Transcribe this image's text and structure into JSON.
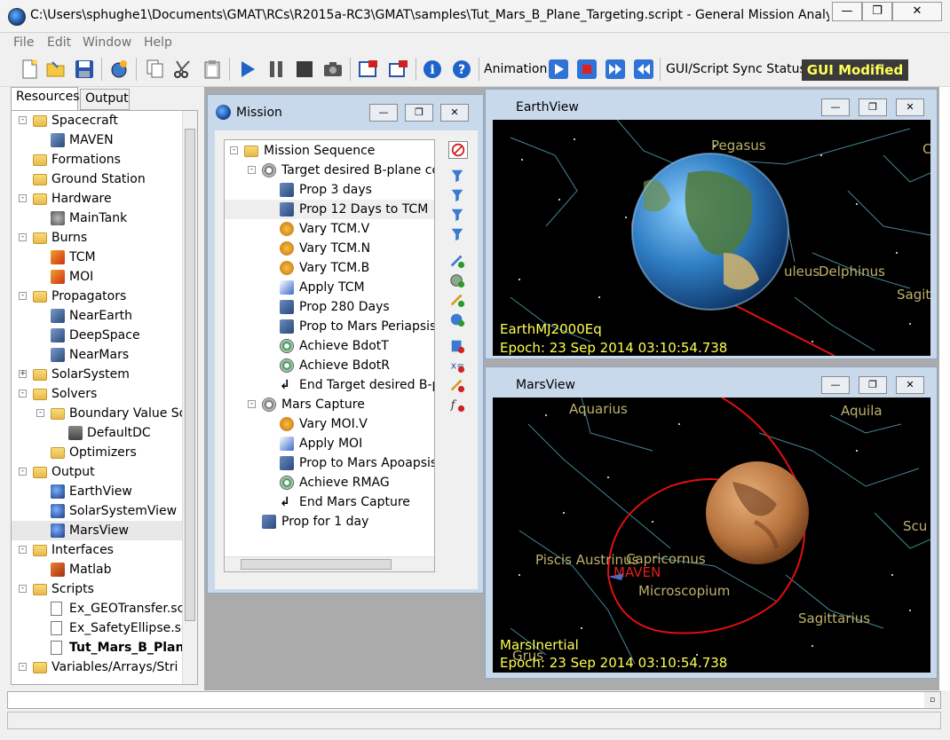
{
  "window": {
    "title": "C:\\Users\\sphughe1\\Documents\\GMAT\\RCs\\R2015a-RC3\\GMAT\\samples\\Tut_Mars_B_Plane_Targeting.script - General Mission Analysis T...",
    "min": "—",
    "max": "❐",
    "close": "✕"
  },
  "menu": {
    "file": "File",
    "edit": "Edit",
    "window": "Window",
    "help": "Help"
  },
  "toolbar": {
    "animation_label": "Animation",
    "sync_label": "GUI/Script Sync Status:",
    "sync_status": "GUI Modified"
  },
  "tabs": {
    "resources": "Resources",
    "output": "Output"
  },
  "resources": {
    "spacecraft": "Spacecraft",
    "maven": "MAVEN",
    "formations": "Formations",
    "ground_station": "Ground Station",
    "hardware": "Hardware",
    "main_tank": "MainTank",
    "burns": "Burns",
    "tcm": "TCM",
    "moi": "MOI",
    "propagators": "Propagators",
    "near_earth": "NearEarth",
    "deep_space": "DeepSpace",
    "near_mars": "NearMars",
    "solar_system": "SolarSystem",
    "solvers": "Solvers",
    "bvs": "Boundary Value Sc",
    "default_dc": "DefaultDC",
    "optimizers": "Optimizers",
    "output": "Output",
    "earth_view": "EarthView",
    "ss_view": "SolarSystemView",
    "mars_view": "MarsView",
    "interfaces": "Interfaces",
    "matlab": "Matlab",
    "scripts": "Scripts",
    "s1": "Ex_GEOTransfer.scr",
    "s2": "Ex_SafetyEllipse.sc",
    "s3": "Tut_Mars_B_Plane",
    "s4": "Variables/Arrays/Stri"
  },
  "mission": {
    "title": "Mission",
    "root": "Mission Sequence",
    "target1": "Target desired B-plane co",
    "items": [
      "Prop 3 days",
      "Prop 12 Days to TCM",
      "Vary TCM.V",
      "Vary TCM.N",
      "Vary TCM.B",
      "Apply TCM",
      "Prop 280 Days",
      "Prop to Mars Periapsis",
      "Achieve BdotT",
      "Achieve BdotR",
      "End Target desired B-p"
    ],
    "target2": "Mars Capture",
    "items2": [
      "Vary MOI.V",
      "Apply MOI",
      "Prop to Mars Apoapsis",
      "Achieve RMAG",
      "End Mars Capture"
    ],
    "last": "Prop for 1 day"
  },
  "earth_view": {
    "title": "EarthView",
    "coord": "EarthMJ2000Eq",
    "epoch": "Epoch: 23 Sep 2014 03:10:54.738",
    "constellations": {
      "pegasus": "Pegasus",
      "delphinus": "Delphinus",
      "culeus": "uleus",
      "sagit": "Sagit",
      "c": "C"
    }
  },
  "mars_view": {
    "title": "MarsView",
    "coord": "MarsInertial",
    "epoch": "Epoch: 23 Sep 2014 03:10:54.738",
    "spacecraft": "MAVEN",
    "constellations": {
      "aquarius": "Aquarius",
      "aquila": "Aquila",
      "capricornus": "Capricornus",
      "piscis": "Piscis Austrinus",
      "microscopium": "Microscopium",
      "sagittarius": "Sagittarius",
      "scu": "Scu",
      "grus": "Grus"
    }
  },
  "colors": {
    "orbit": "#e01010",
    "label": "#ffff50",
    "constellation": "#bdb16b",
    "mdi": "#ababab"
  }
}
